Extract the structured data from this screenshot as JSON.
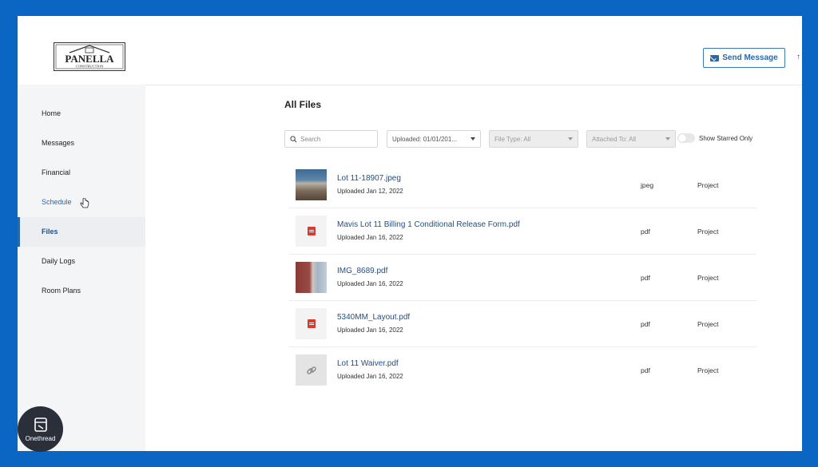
{
  "brand": {
    "logo_text": "PANELLA",
    "logo_subtext": "CONSTRUCTION"
  },
  "header": {
    "send_message_label": "Send Message",
    "extra_glyph": "↑"
  },
  "sidebar": {
    "items": [
      {
        "label": "Home"
      },
      {
        "label": "Messages"
      },
      {
        "label": "Financial"
      },
      {
        "label": "Schedule"
      },
      {
        "label": "Files"
      },
      {
        "label": "Daily Logs"
      },
      {
        "label": "Room Plans"
      }
    ],
    "active": "Files",
    "hovered": "Schedule"
  },
  "main": {
    "title": "All Files",
    "filters": {
      "search_placeholder": "Search",
      "uploaded": "Uploaded: 01/01/201...",
      "file_type": "File Type: All",
      "attached_to": "Attached To: All",
      "starred_label": "Show Starred Only",
      "starred_on": false
    },
    "files": [
      {
        "name": "Lot 11-18907.jpeg",
        "uploaded": "Uploaded Jan 12, 2022",
        "type": "jpeg",
        "attached": "Project",
        "thumb": "photo-site"
      },
      {
        "name": "Mavis Lot 11 Billing 1 Conditional Release Form.pdf",
        "uploaded": "Uploaded Jan 16, 2022",
        "type": "pdf",
        "attached": "Project",
        "thumb": "pdf-icon"
      },
      {
        "name": "IMG_8689.pdf",
        "uploaded": "Uploaded Jan 16, 2022",
        "type": "pdf",
        "attached": "Project",
        "thumb": "photo-house"
      },
      {
        "name": "5340MM_Layout.pdf",
        "uploaded": "Uploaded Jan 16, 2022",
        "type": "pdf",
        "attached": "Project",
        "thumb": "pdf-icon"
      },
      {
        "name": "Lot 11 Waiver.pdf",
        "uploaded": "Uploaded Jan 16, 2022",
        "type": "pdf",
        "attached": "Project",
        "thumb": "link-icon"
      }
    ]
  },
  "watermark": {
    "label": "Onethread"
  },
  "colors": {
    "frame": "#0a66c2",
    "accent": "#2a68a6",
    "pdf": "#d73a2e"
  }
}
